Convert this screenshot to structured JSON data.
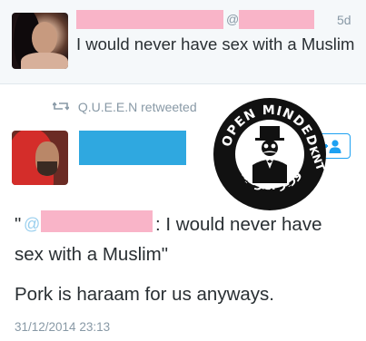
{
  "quoted_tweet": {
    "at_symbol": "@",
    "time": "5d",
    "text": "I would never have sex with a Muslim"
  },
  "retweet_header": {
    "icon": "retweet-icon",
    "label": "Q.U.E.E.N retweeted"
  },
  "stamp": {
    "top_text": "OPEN MINDED",
    "right_text": "KNT",
    "arabic_text": "وزير الترفيه"
  },
  "main_tweet": {
    "follow_icon": "follow-user-icon",
    "quote_open": "\"",
    "quote_at": "@",
    "quote_rest": ": I would never have",
    "quote_line2": "sex with a Muslim\"",
    "reply_text": "Pork is haraam for us anyways.",
    "timestamp": "31/12/2014 23:13"
  },
  "colors": {
    "redaction_pink": "#f9b4c8",
    "redaction_blue": "#2fa8e0",
    "twitter_blue": "#1da1f2",
    "muted_text": "#8899a6",
    "body_text": "#292f33"
  }
}
